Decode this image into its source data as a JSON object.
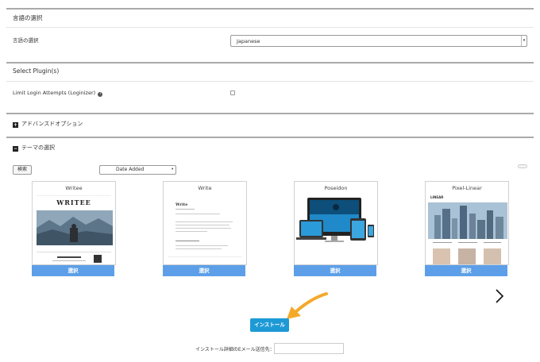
{
  "language_section": {
    "title": "言語の選択",
    "label": "言語の選択",
    "value": "Japanese"
  },
  "plugins_section": {
    "title": "Select Plugin(s)",
    "items": [
      {
        "label": "Limit Login Attempts (Loginizer)",
        "info_icon": "i",
        "checked": false
      }
    ]
  },
  "advanced": {
    "label": "アドバンスドオプション",
    "toggle": "+"
  },
  "theme_section": {
    "title": "テーマの選択",
    "toggle": "−",
    "search_label": "検索",
    "sort_value": "Date Added",
    "themes": [
      {
        "name": "Writee",
        "select_label": "選択",
        "preview_heading": "WRITEE"
      },
      {
        "name": "Write",
        "select_label": "選択",
        "preview_heading": "Write"
      },
      {
        "name": "Poseidon",
        "select_label": "選択"
      },
      {
        "name": "Pixel-Linear",
        "select_label": "選択",
        "preview_heading": "LINEAR"
      }
    ],
    "next_icon": "chevron-right-icon"
  },
  "install_button": "インストール",
  "email_label": "インストール詳細のEメール送信先：:",
  "email_value": "",
  "colors": {
    "select_button": "#5c9fe8",
    "install_button": "#1d9ad6",
    "pointer_arrow": "#f4a92a"
  }
}
